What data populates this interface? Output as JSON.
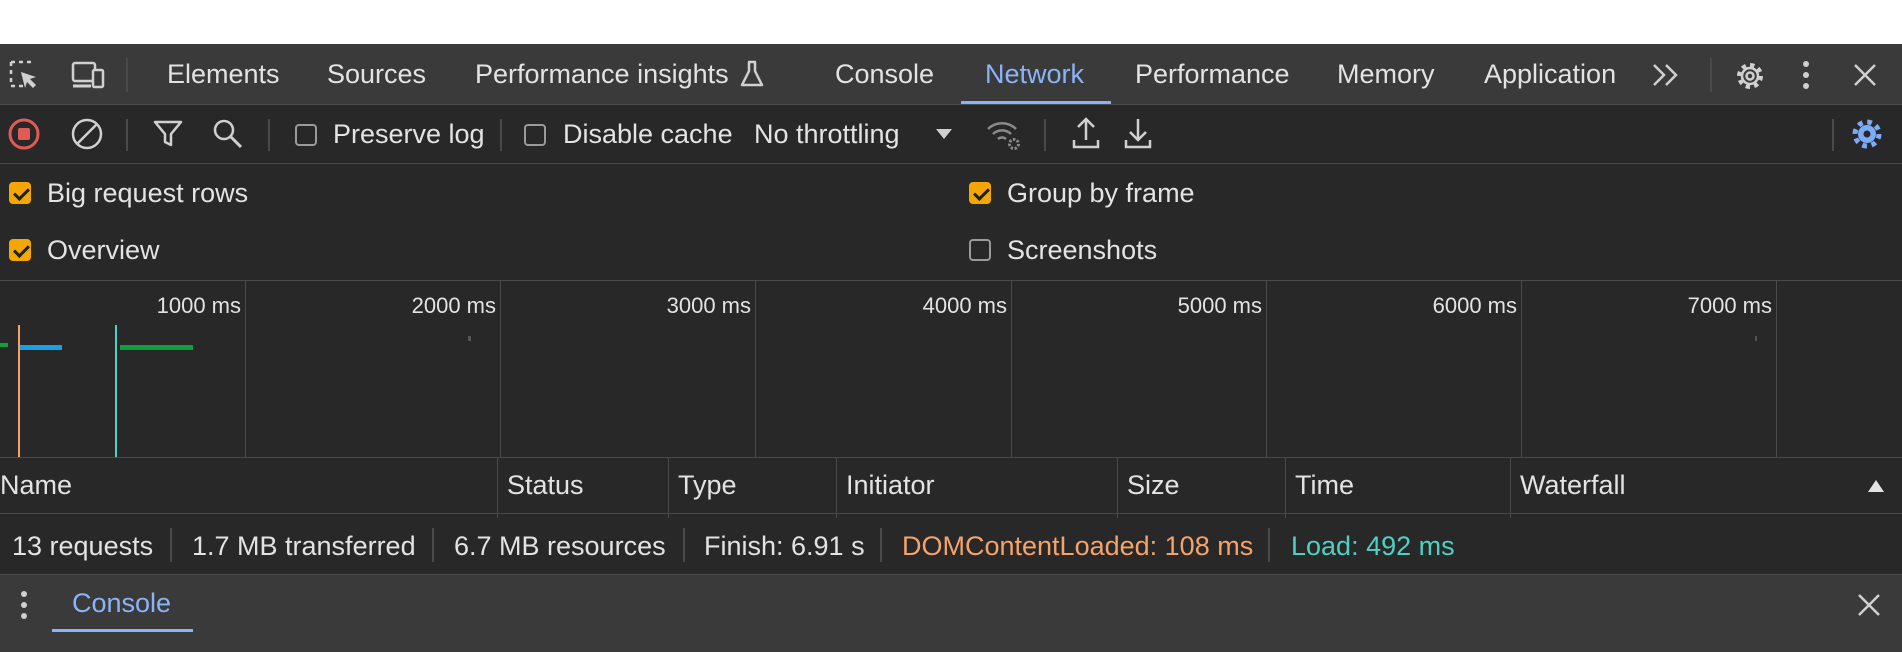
{
  "tabs": [
    "Elements",
    "Sources",
    "Performance insights",
    "Console",
    "Network",
    "Performance",
    "Memory",
    "Application"
  ],
  "active_tab": "Network",
  "toolbar": {
    "preserve_log_label": "Preserve log",
    "preserve_log_checked": false,
    "disable_cache_label": "Disable cache",
    "disable_cache_checked": false,
    "throttling_value": "No throttling"
  },
  "settings": {
    "big_request_rows_label": "Big request rows",
    "big_request_rows_checked": true,
    "group_by_frame_label": "Group by frame",
    "group_by_frame_checked": true,
    "overview_label": "Overview",
    "overview_checked": true,
    "screenshots_label": "Screenshots",
    "screenshots_checked": false
  },
  "overview": {
    "ticks": [
      "1000 ms",
      "2000 ms",
      "3000 ms",
      "4000 ms",
      "5000 ms",
      "6000 ms",
      "7000 ms"
    ],
    "colors": {
      "dom_content_loaded": "#f4a36b",
      "load": "#4ed1c2",
      "waiting": "#1a9fe3",
      "downloading": "#0f9d3e"
    }
  },
  "columns": [
    "Name",
    "Status",
    "Type",
    "Initiator",
    "Size",
    "Time",
    "Waterfall"
  ],
  "status_bar": {
    "requests": "13 requests",
    "transferred": "1.7 MB transferred",
    "resources": "6.7 MB resources",
    "finish": "Finish: 6.91 s",
    "dom_content_loaded": "DOMContentLoaded: 108 ms",
    "load": "Load: 492 ms"
  },
  "drawer": {
    "tab_label": "Console"
  },
  "colors": {
    "accent": "#8ab4f8",
    "checkbox_on": "#f2a800",
    "record_red": "#e05b56",
    "settings_blue": "#7cacf8"
  }
}
